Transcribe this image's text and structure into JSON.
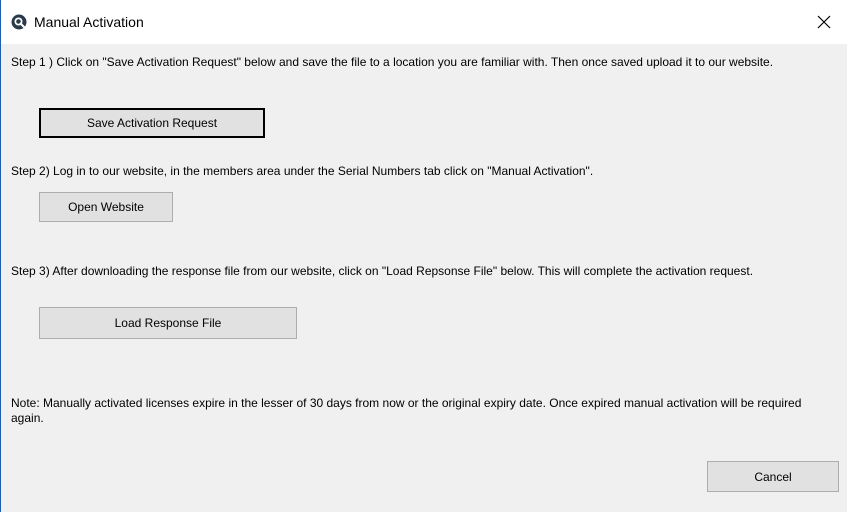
{
  "window": {
    "title": "Manual Activation",
    "close_glyph": "✕",
    "app_icon": "q-logo-icon",
    "accent": "#1a5fb4"
  },
  "steps": {
    "step1": "Step 1 ) Click on \"Save Activation Request\" below and save the file to a location you are familiar with. Then once saved upload it to our website.",
    "step2": "Step 2) Log in to our website, in the members area under the Serial Numbers tab click on \"Manual Activation\".",
    "step3": "Step 3) After downloading the response file from our website, click on \"Load Repsonse File\" below. This will complete the activation request.",
    "note": "Note: Manually activated licenses expire in the lesser of 30 days from now or the original expiry date. Once expired manual activation will be required again."
  },
  "buttons": {
    "save_request": "Save Activation Request",
    "open_website": "Open Website",
    "load_response": "Load Response File",
    "cancel": "Cancel"
  }
}
